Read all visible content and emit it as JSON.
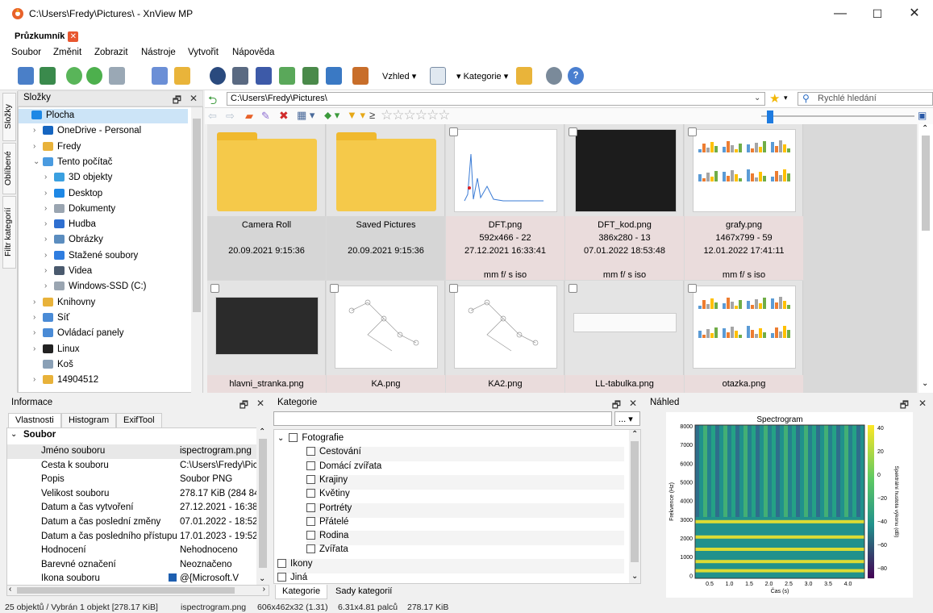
{
  "window": {
    "title": "C:\\Users\\Fredy\\Pictures\\ - XnView MP",
    "min_glyph": "—",
    "max_glyph": "☐",
    "close_glyph": "✕"
  },
  "tab": {
    "label": "Průzkumník"
  },
  "menu": [
    "Soubor",
    "Změnit",
    "Zobrazit",
    "Nástroje",
    "Vytvořit",
    "Nápověda"
  ],
  "toolbar": {
    "view_label": "Vzhled",
    "category_label": "Kategorie"
  },
  "folders_panel": {
    "title": "Složky",
    "side_tabs": [
      "Složky",
      "Oblíbené",
      "Filtr kategorií"
    ],
    "items": [
      {
        "label": "Plocha",
        "indent": 0,
        "arrow": "",
        "icon": "desktop-icon",
        "color": "#1e88e5"
      },
      {
        "label": "OneDrive - Personal",
        "indent": 1,
        "arrow": "›",
        "icon": "cloud-icon",
        "color": "#1565c0"
      },
      {
        "label": "Fredy",
        "indent": 1,
        "arrow": "›",
        "icon": "user-folder-icon",
        "color": "#e8b23a"
      },
      {
        "label": "Tento počítač",
        "indent": 1,
        "arrow": "⌄",
        "icon": "computer-icon",
        "color": "#4a9be0"
      },
      {
        "label": "3D objekty",
        "indent": 2,
        "arrow": "›",
        "icon": "cube-icon",
        "color": "#3ba0e0"
      },
      {
        "label": "Desktop",
        "indent": 2,
        "arrow": "›",
        "icon": "desktop-icon",
        "color": "#1e88e5"
      },
      {
        "label": "Dokumenty",
        "indent": 2,
        "arrow": "›",
        "icon": "document-icon",
        "color": "#9aa5b1"
      },
      {
        "label": "Hudba",
        "indent": 2,
        "arrow": "›",
        "icon": "music-icon",
        "color": "#2f6fd0"
      },
      {
        "label": "Obrázky",
        "indent": 2,
        "arrow": "›",
        "icon": "picture-icon",
        "color": "#5b8dbf"
      },
      {
        "label": "Stažené soubory",
        "indent": 2,
        "arrow": "›",
        "icon": "download-icon",
        "color": "#2f7de0"
      },
      {
        "label": "Videa",
        "indent": 2,
        "arrow": "›",
        "icon": "video-icon",
        "color": "#4a5a6e"
      },
      {
        "label": "Windows-SSD (C:)",
        "indent": 2,
        "arrow": "›",
        "icon": "drive-icon",
        "color": "#9aa5b1"
      },
      {
        "label": "Knihovny",
        "indent": 1,
        "arrow": "›",
        "icon": "library-icon",
        "color": "#e8b23a"
      },
      {
        "label": "Síť",
        "indent": 1,
        "arrow": "›",
        "icon": "network-icon",
        "color": "#4a8bd6"
      },
      {
        "label": "Ovládací panely",
        "indent": 1,
        "arrow": "›",
        "icon": "control-panel-icon",
        "color": "#4a8bd6"
      },
      {
        "label": "Linux",
        "indent": 1,
        "arrow": "›",
        "icon": "linux-icon",
        "color": "#222222"
      },
      {
        "label": "Koš",
        "indent": 1,
        "arrow": "",
        "icon": "recycle-bin-icon",
        "color": "#8aa0b6"
      },
      {
        "label": "14904512",
        "indent": 1,
        "arrow": "›",
        "icon": "folder-icon",
        "color": "#e8b23a"
      }
    ]
  },
  "path": {
    "value": "C:\\Users\\Fredy\\Pictures\\",
    "search_placeholder": "Rychlé hledání"
  },
  "thumbnails": [
    {
      "name": "Camera Roll",
      "line2": "",
      "date": "20.09.2021 9:15:36",
      "exif": "",
      "kind": "folder"
    },
    {
      "name": "Saved Pictures",
      "line2": "",
      "date": "20.09.2021 9:15:36",
      "exif": "",
      "kind": "folder"
    },
    {
      "name": "DFT.png",
      "line2": "592x466 - 22",
      "date": "27.12.2021 16:33:41",
      "exif": "mm f/ s iso",
      "kind": "plot"
    },
    {
      "name": "DFT_kod.png",
      "line2": "386x280 - 13",
      "date": "07.01.2022 18:53:48",
      "exif": "mm f/ s iso",
      "kind": "code"
    },
    {
      "name": "grafy.png",
      "line2": "1467x799 - 59",
      "date": "12.01.2022 17:41:11",
      "exif": "mm f/ s iso",
      "kind": "bars"
    },
    {
      "name": "hlavni_stranka.png",
      "kind": "dark"
    },
    {
      "name": "KA.png",
      "kind": "graph"
    },
    {
      "name": "KA2.png",
      "kind": "graph"
    },
    {
      "name": "LL-tabulka.png",
      "kind": "table"
    },
    {
      "name": "otazka.png",
      "kind": "bars"
    }
  ],
  "info_panel": {
    "title": "Informace",
    "tabs": [
      "Vlastnosti",
      "Histogram",
      "ExifTool"
    ],
    "group": "Soubor",
    "props": [
      {
        "k": "Jméno souboru",
        "v": "ispectrogram.png"
      },
      {
        "k": "Cesta k souboru",
        "v": "C:\\Users\\Fredy\\Pic"
      },
      {
        "k": "Popis",
        "v": "Soubor PNG"
      },
      {
        "k": "Velikost souboru",
        "v": "278.17 KiB (284 84"
      },
      {
        "k": "Datum a čas vytvoření",
        "v": "27.12.2021 - 16:38"
      },
      {
        "k": "Datum a čas poslední změny",
        "v": "07.01.2022 - 18:52"
      },
      {
        "k": "Datum a čas posledního přístupu",
        "v": "17.01.2023 - 19:52"
      },
      {
        "k": "Hodnocení",
        "v": "Nehodnoceno"
      },
      {
        "k": "Barevné označení",
        "v": "Neoznačeno"
      },
      {
        "k": "Ikona souboru",
        "v": "@{Microsoft.V"
      }
    ]
  },
  "category_panel": {
    "title": "Kategorie",
    "filter_button": "...",
    "items": [
      {
        "label": "Fotografie",
        "level": 0,
        "expand": "⌄"
      },
      {
        "label": "Cestování",
        "level": 1
      },
      {
        "label": "Domácí zvířata",
        "level": 1
      },
      {
        "label": "Krajiny",
        "level": 1
      },
      {
        "label": "Květiny",
        "level": 1
      },
      {
        "label": "Portréty",
        "level": 1
      },
      {
        "label": "Přátelé",
        "level": 1
      },
      {
        "label": "Rodina",
        "level": 1
      },
      {
        "label": "Zvířata",
        "level": 1
      },
      {
        "label": "Ikony",
        "level": 0
      },
      {
        "label": "Jiná",
        "level": 0
      }
    ],
    "tabs": [
      "Kategorie",
      "Sady kategorií"
    ]
  },
  "preview_panel": {
    "title": "Náhled",
    "chart_title": "Spectrogram",
    "ylabel": "Frekvence (Hz)",
    "xlabel": "Čas (s)",
    "yticks": [
      "8000",
      "7000",
      "6000",
      "5000",
      "4000",
      "3000",
      "2000",
      "1000",
      "0"
    ],
    "xticks": [
      "0.5",
      "1.0",
      "1.5",
      "2.0",
      "2.5",
      "3.0",
      "3.5",
      "4.0"
    ],
    "cbar_label": "Spektrální hustota výkonu (dB)",
    "cbar_ticks": [
      "40",
      "20",
      "0",
      "−20",
      "−40",
      "−60",
      "−80"
    ]
  },
  "status": {
    "parts": [
      "25 objektů / Vybrán 1 objekt [278.17 KiB]",
      "ispectrogram.png",
      "606x462x32 (1.31)",
      "6.31x4.81 palců",
      "278.17 KiB"
    ]
  }
}
